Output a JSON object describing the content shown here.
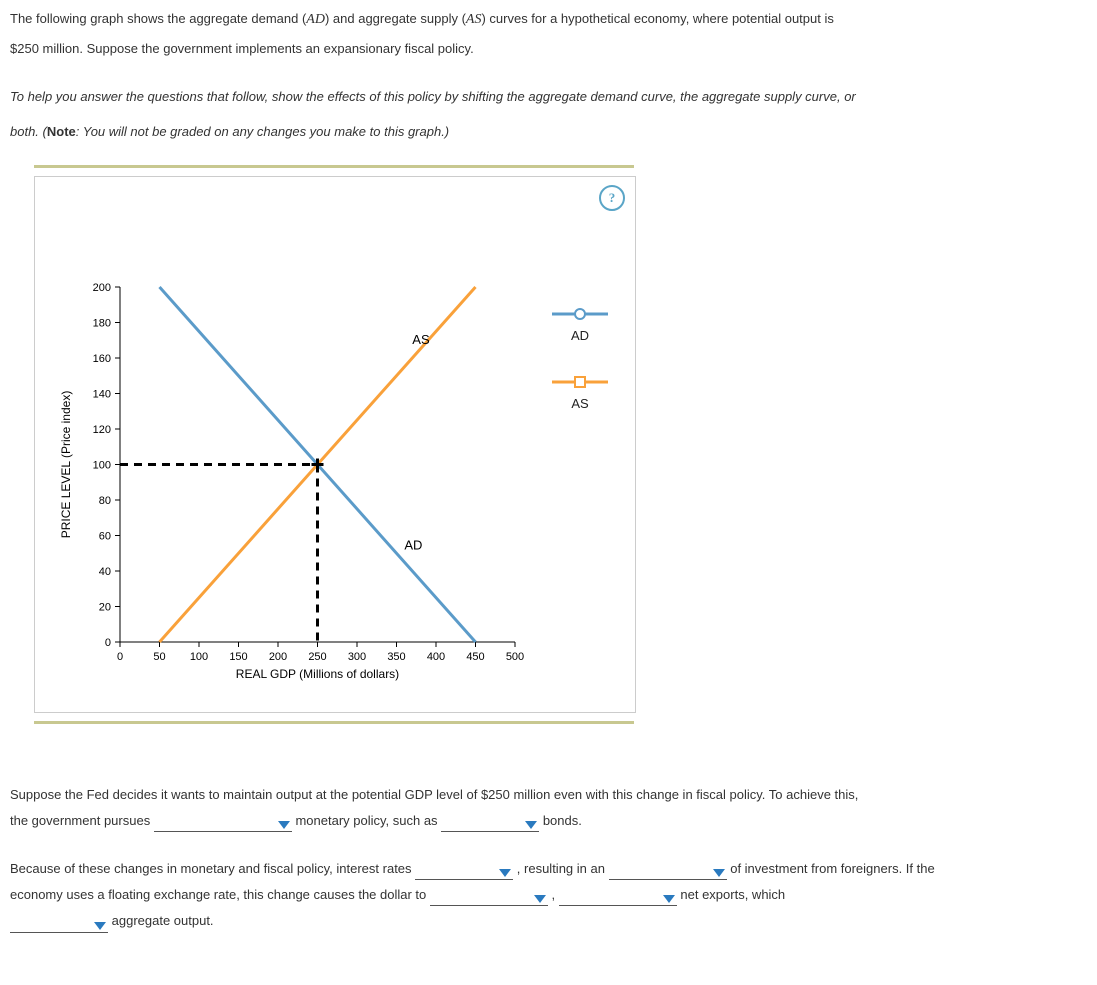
{
  "intro": {
    "line1_a": "The following graph shows the aggregate demand (",
    "line1_ad": "AD",
    "line1_b": ") and aggregate supply (",
    "line1_as": "AS",
    "line1_c": ") curves for a hypothetical economy, where potential output is",
    "line2": "$250 million. Suppose the government implements an expansionary fiscal policy."
  },
  "instructions": {
    "line1": "To help you answer the questions that follow, show the effects of this policy by shifting the aggregate demand curve, the aggregate supply curve, or",
    "line2_a": "both. (",
    "line2_note": "Note",
    "line2_b": ": You will not be graded on any changes you make to this graph.)"
  },
  "chart_data": {
    "type": "line",
    "title": "",
    "xlabel": "REAL GDP (Millions of dollars)",
    "ylabel": "PRICE LEVEL (Price index)",
    "xlim": [
      0,
      500
    ],
    "ylim": [
      0,
      200
    ],
    "x_ticks": [
      0,
      50,
      100,
      150,
      200,
      250,
      300,
      350,
      400,
      450,
      500
    ],
    "y_ticks": [
      0,
      20,
      40,
      60,
      80,
      100,
      120,
      140,
      160,
      180,
      200
    ],
    "grid": false,
    "series": [
      {
        "name": "AD",
        "color": "#5b9bc9",
        "points": [
          [
            50,
            200
          ],
          [
            450,
            0
          ]
        ]
      },
      {
        "name": "AS",
        "color": "#f9a13a",
        "points": [
          [
            50,
            0
          ],
          [
            450,
            200
          ]
        ]
      }
    ],
    "equilibrium": {
      "x": 250,
      "y": 100
    },
    "line_labels": [
      {
        "text": "AS",
        "x": 370,
        "y": 168
      },
      {
        "text": "AD",
        "x": 360,
        "y": 52
      }
    ],
    "legend": [
      {
        "name": "AD",
        "color": "#5b9bc9",
        "shape": "circle"
      },
      {
        "name": "AS",
        "color": "#f9a13a",
        "shape": "square"
      }
    ]
  },
  "help_icon": "?",
  "questions": {
    "p1_a": "Suppose the Fed decides it wants to maintain output at the potential GDP level of $250 million even with this change in fiscal policy. To achieve this,",
    "p1_b": "the government pursues",
    "p1_c": "monetary policy, such as",
    "p1_d": "bonds.",
    "p2_a": "Because of these changes in monetary and fiscal policy, interest rates",
    "p2_b": ", resulting in an",
    "p2_c": "of investment from foreigners. If the",
    "p2_d": "economy uses a floating exchange rate, this change causes the dollar to",
    "p2_e": ",",
    "p2_f": "net exports, which",
    "p2_g": "aggregate output."
  }
}
